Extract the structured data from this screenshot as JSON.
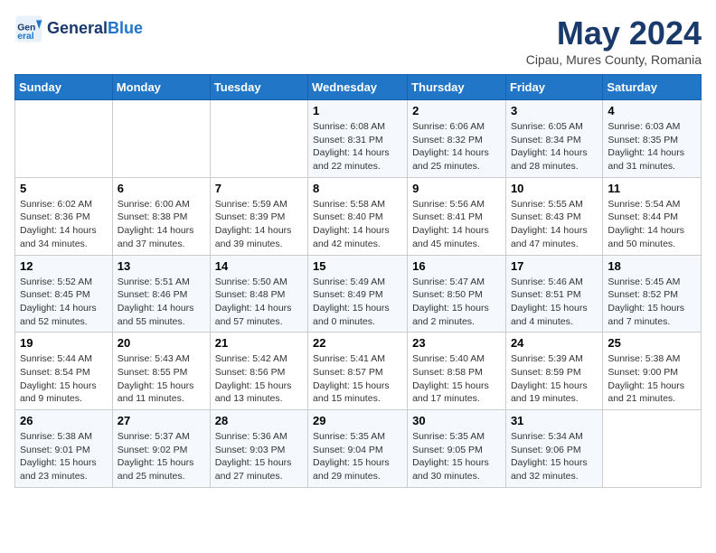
{
  "header": {
    "logo_line1": "General",
    "logo_line2": "Blue",
    "month": "May 2024",
    "location": "Cipau, Mures County, Romania"
  },
  "weekdays": [
    "Sunday",
    "Monday",
    "Tuesday",
    "Wednesday",
    "Thursday",
    "Friday",
    "Saturday"
  ],
  "weeks": [
    [
      {
        "day": "",
        "info": ""
      },
      {
        "day": "",
        "info": ""
      },
      {
        "day": "",
        "info": ""
      },
      {
        "day": "1",
        "info": "Sunrise: 6:08 AM\nSunset: 8:31 PM\nDaylight: 14 hours\nand 22 minutes."
      },
      {
        "day": "2",
        "info": "Sunrise: 6:06 AM\nSunset: 8:32 PM\nDaylight: 14 hours\nand 25 minutes."
      },
      {
        "day": "3",
        "info": "Sunrise: 6:05 AM\nSunset: 8:34 PM\nDaylight: 14 hours\nand 28 minutes."
      },
      {
        "day": "4",
        "info": "Sunrise: 6:03 AM\nSunset: 8:35 PM\nDaylight: 14 hours\nand 31 minutes."
      }
    ],
    [
      {
        "day": "5",
        "info": "Sunrise: 6:02 AM\nSunset: 8:36 PM\nDaylight: 14 hours\nand 34 minutes."
      },
      {
        "day": "6",
        "info": "Sunrise: 6:00 AM\nSunset: 8:38 PM\nDaylight: 14 hours\nand 37 minutes."
      },
      {
        "day": "7",
        "info": "Sunrise: 5:59 AM\nSunset: 8:39 PM\nDaylight: 14 hours\nand 39 minutes."
      },
      {
        "day": "8",
        "info": "Sunrise: 5:58 AM\nSunset: 8:40 PM\nDaylight: 14 hours\nand 42 minutes."
      },
      {
        "day": "9",
        "info": "Sunrise: 5:56 AM\nSunset: 8:41 PM\nDaylight: 14 hours\nand 45 minutes."
      },
      {
        "day": "10",
        "info": "Sunrise: 5:55 AM\nSunset: 8:43 PM\nDaylight: 14 hours\nand 47 minutes."
      },
      {
        "day": "11",
        "info": "Sunrise: 5:54 AM\nSunset: 8:44 PM\nDaylight: 14 hours\nand 50 minutes."
      }
    ],
    [
      {
        "day": "12",
        "info": "Sunrise: 5:52 AM\nSunset: 8:45 PM\nDaylight: 14 hours\nand 52 minutes."
      },
      {
        "day": "13",
        "info": "Sunrise: 5:51 AM\nSunset: 8:46 PM\nDaylight: 14 hours\nand 55 minutes."
      },
      {
        "day": "14",
        "info": "Sunrise: 5:50 AM\nSunset: 8:48 PM\nDaylight: 14 hours\nand 57 minutes."
      },
      {
        "day": "15",
        "info": "Sunrise: 5:49 AM\nSunset: 8:49 PM\nDaylight: 15 hours\nand 0 minutes."
      },
      {
        "day": "16",
        "info": "Sunrise: 5:47 AM\nSunset: 8:50 PM\nDaylight: 15 hours\nand 2 minutes."
      },
      {
        "day": "17",
        "info": "Sunrise: 5:46 AM\nSunset: 8:51 PM\nDaylight: 15 hours\nand 4 minutes."
      },
      {
        "day": "18",
        "info": "Sunrise: 5:45 AM\nSunset: 8:52 PM\nDaylight: 15 hours\nand 7 minutes."
      }
    ],
    [
      {
        "day": "19",
        "info": "Sunrise: 5:44 AM\nSunset: 8:54 PM\nDaylight: 15 hours\nand 9 minutes."
      },
      {
        "day": "20",
        "info": "Sunrise: 5:43 AM\nSunset: 8:55 PM\nDaylight: 15 hours\nand 11 minutes."
      },
      {
        "day": "21",
        "info": "Sunrise: 5:42 AM\nSunset: 8:56 PM\nDaylight: 15 hours\nand 13 minutes."
      },
      {
        "day": "22",
        "info": "Sunrise: 5:41 AM\nSunset: 8:57 PM\nDaylight: 15 hours\nand 15 minutes."
      },
      {
        "day": "23",
        "info": "Sunrise: 5:40 AM\nSunset: 8:58 PM\nDaylight: 15 hours\nand 17 minutes."
      },
      {
        "day": "24",
        "info": "Sunrise: 5:39 AM\nSunset: 8:59 PM\nDaylight: 15 hours\nand 19 minutes."
      },
      {
        "day": "25",
        "info": "Sunrise: 5:38 AM\nSunset: 9:00 PM\nDaylight: 15 hours\nand 21 minutes."
      }
    ],
    [
      {
        "day": "26",
        "info": "Sunrise: 5:38 AM\nSunset: 9:01 PM\nDaylight: 15 hours\nand 23 minutes."
      },
      {
        "day": "27",
        "info": "Sunrise: 5:37 AM\nSunset: 9:02 PM\nDaylight: 15 hours\nand 25 minutes."
      },
      {
        "day": "28",
        "info": "Sunrise: 5:36 AM\nSunset: 9:03 PM\nDaylight: 15 hours\nand 27 minutes."
      },
      {
        "day": "29",
        "info": "Sunrise: 5:35 AM\nSunset: 9:04 PM\nDaylight: 15 hours\nand 29 minutes."
      },
      {
        "day": "30",
        "info": "Sunrise: 5:35 AM\nSunset: 9:05 PM\nDaylight: 15 hours\nand 30 minutes."
      },
      {
        "day": "31",
        "info": "Sunrise: 5:34 AM\nSunset: 9:06 PM\nDaylight: 15 hours\nand 32 minutes."
      },
      {
        "day": "",
        "info": ""
      }
    ]
  ]
}
